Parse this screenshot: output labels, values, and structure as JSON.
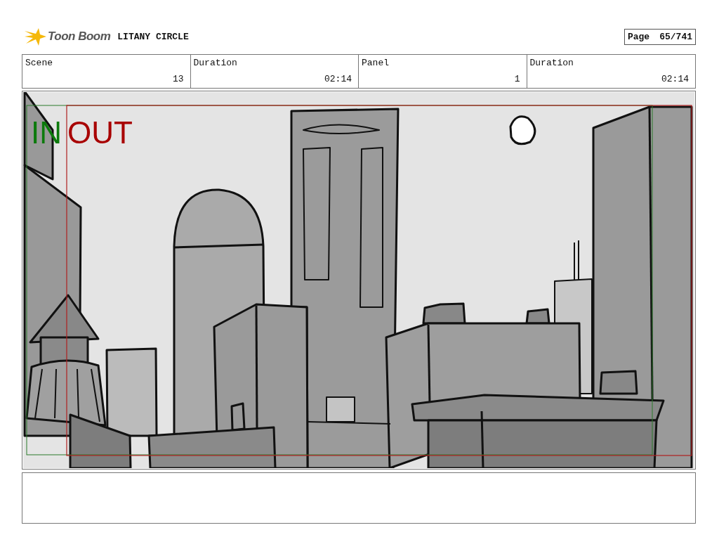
{
  "header": {
    "logo_text": "Toon Boom",
    "title": "LITANY CIRCLE",
    "page_label": "Page",
    "page_number": "65/741"
  },
  "fields": [
    {
      "label": "Scene",
      "value": "13"
    },
    {
      "label": "Duration",
      "value": "02:14"
    },
    {
      "label": "Panel",
      "value": "1"
    },
    {
      "label": "Duration",
      "value": "02:14"
    }
  ],
  "panel": {
    "in_label": "IN",
    "out_label": "OUT"
  }
}
